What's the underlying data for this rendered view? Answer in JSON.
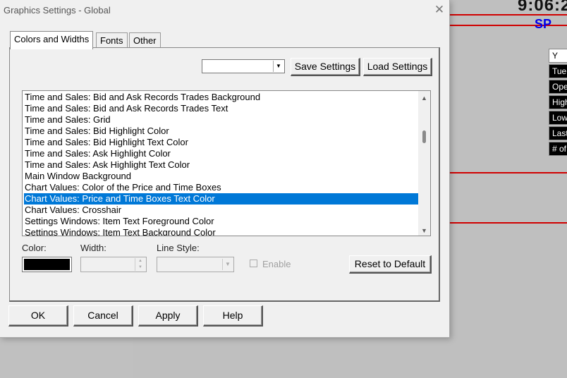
{
  "background": {
    "clock": "9:06:2",
    "symbol": "SP",
    "data_rows": [
      "Y",
      "Tue",
      "Ope",
      "High",
      "Low",
      "Last",
      "# of"
    ]
  },
  "dialog": {
    "title": "Graphics Settings - Global",
    "close_glyph": "✕",
    "tabs": [
      {
        "label": "Colors and Widths",
        "active": true
      },
      {
        "label": "Fonts",
        "active": false
      },
      {
        "label": "Other",
        "active": false
      }
    ],
    "settings_combo": {
      "value": ""
    },
    "save_settings": "Save Settings",
    "load_settings": "Load Settings",
    "items": [
      "Time and Sales: Bid and Ask Records Trades Background",
      "Time and Sales: Bid and Ask Records Trades Text",
      "Time and Sales: Grid",
      "Time and Sales: Bid Highlight Color",
      "Time and Sales: Bid Highlight Text Color",
      "Time and Sales: Ask Highlight Color",
      "Time and Sales: Ask Highlight Text Color",
      "Main Window Background",
      "Chart Values: Color of the Price and Time Boxes",
      "Chart Values: Price and Time Boxes Text Color",
      "Chart Values: Crosshair",
      "Settings Windows: Item Text Foreground Color",
      "Settings Windows: Item Text Background Color"
    ],
    "selected_index": 9,
    "color_label": "Color:",
    "width_label": "Width:",
    "line_style_label": "Line Style:",
    "enable_label": "Enable",
    "reset_button": "Reset to Default",
    "selected_color": "#000000",
    "buttons": {
      "ok": "OK",
      "cancel": "Cancel",
      "apply": "Apply",
      "help": "Help"
    }
  },
  "colors": {
    "selection": "#0078d7",
    "chart_line": "#d00000",
    "symbol": "#0000ee"
  }
}
